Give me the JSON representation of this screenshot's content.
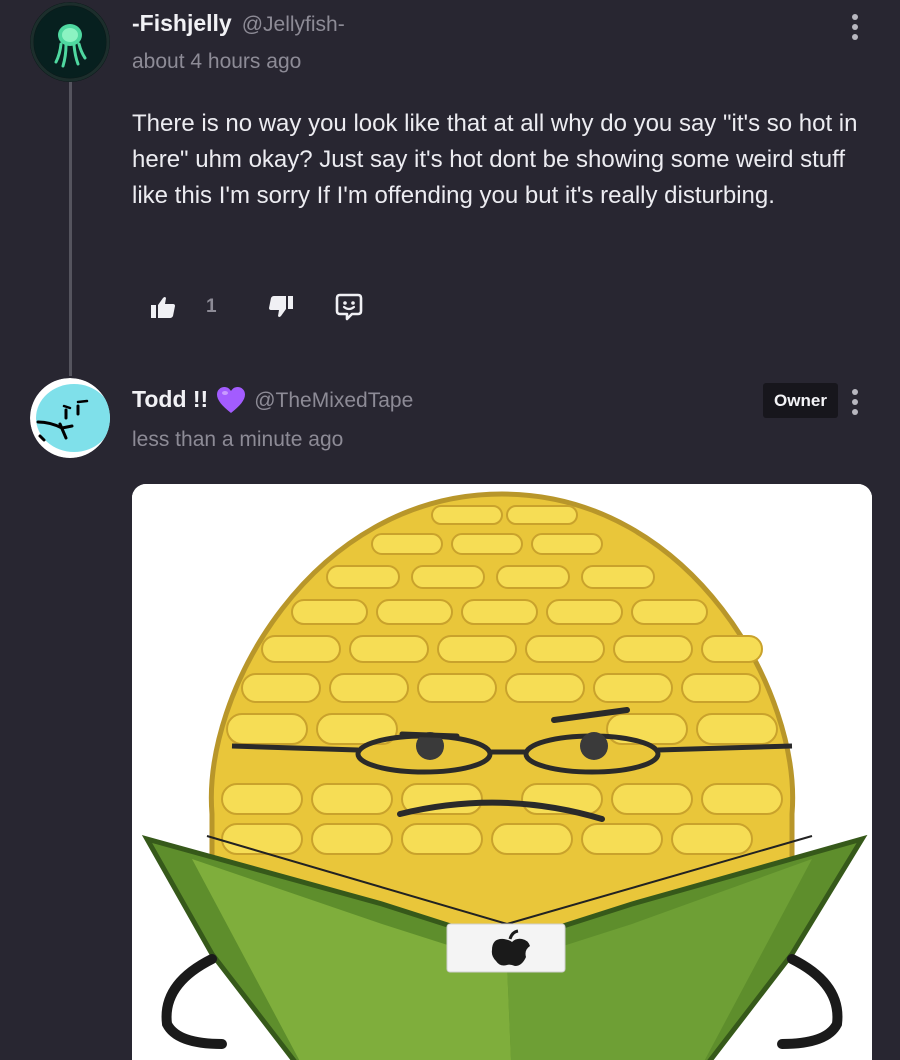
{
  "comments": [
    {
      "author": {
        "display_name": "-Fishjelly",
        "handle": "@Jellyfish-",
        "avatar": "jellyfish-avatar"
      },
      "timestamp": "about 4 hours ago",
      "body": "There is no way you look like that at all why do you say \"it's so hot in here\" uhm okay? Just say it's hot dont be showing some weird stuff like this I'm sorry If I'm offending you but it's really disturbing.",
      "actions": {
        "like_icon": "thumbs-up-icon",
        "like_count": "1",
        "dislike_icon": "thumbs-down-icon",
        "reply_icon": "reply-icon"
      },
      "menu_icon": "more-vertical-icon"
    },
    {
      "author": {
        "display_name": "Todd !!",
        "emoji": "purple-heart-icon",
        "handle": "@TheMixedTape",
        "avatar": "cartoon-character-avatar"
      },
      "timestamp": "less than a minute ago",
      "badge": "Owner",
      "attachment": "corn-cartoon-image",
      "menu_icon": "more-vertical-icon"
    }
  ],
  "colors": {
    "background": "#282631",
    "text": "#ececf1",
    "muted": "#8d8b96",
    "badge_bg": "#17161c",
    "heart": "#a35cff"
  }
}
